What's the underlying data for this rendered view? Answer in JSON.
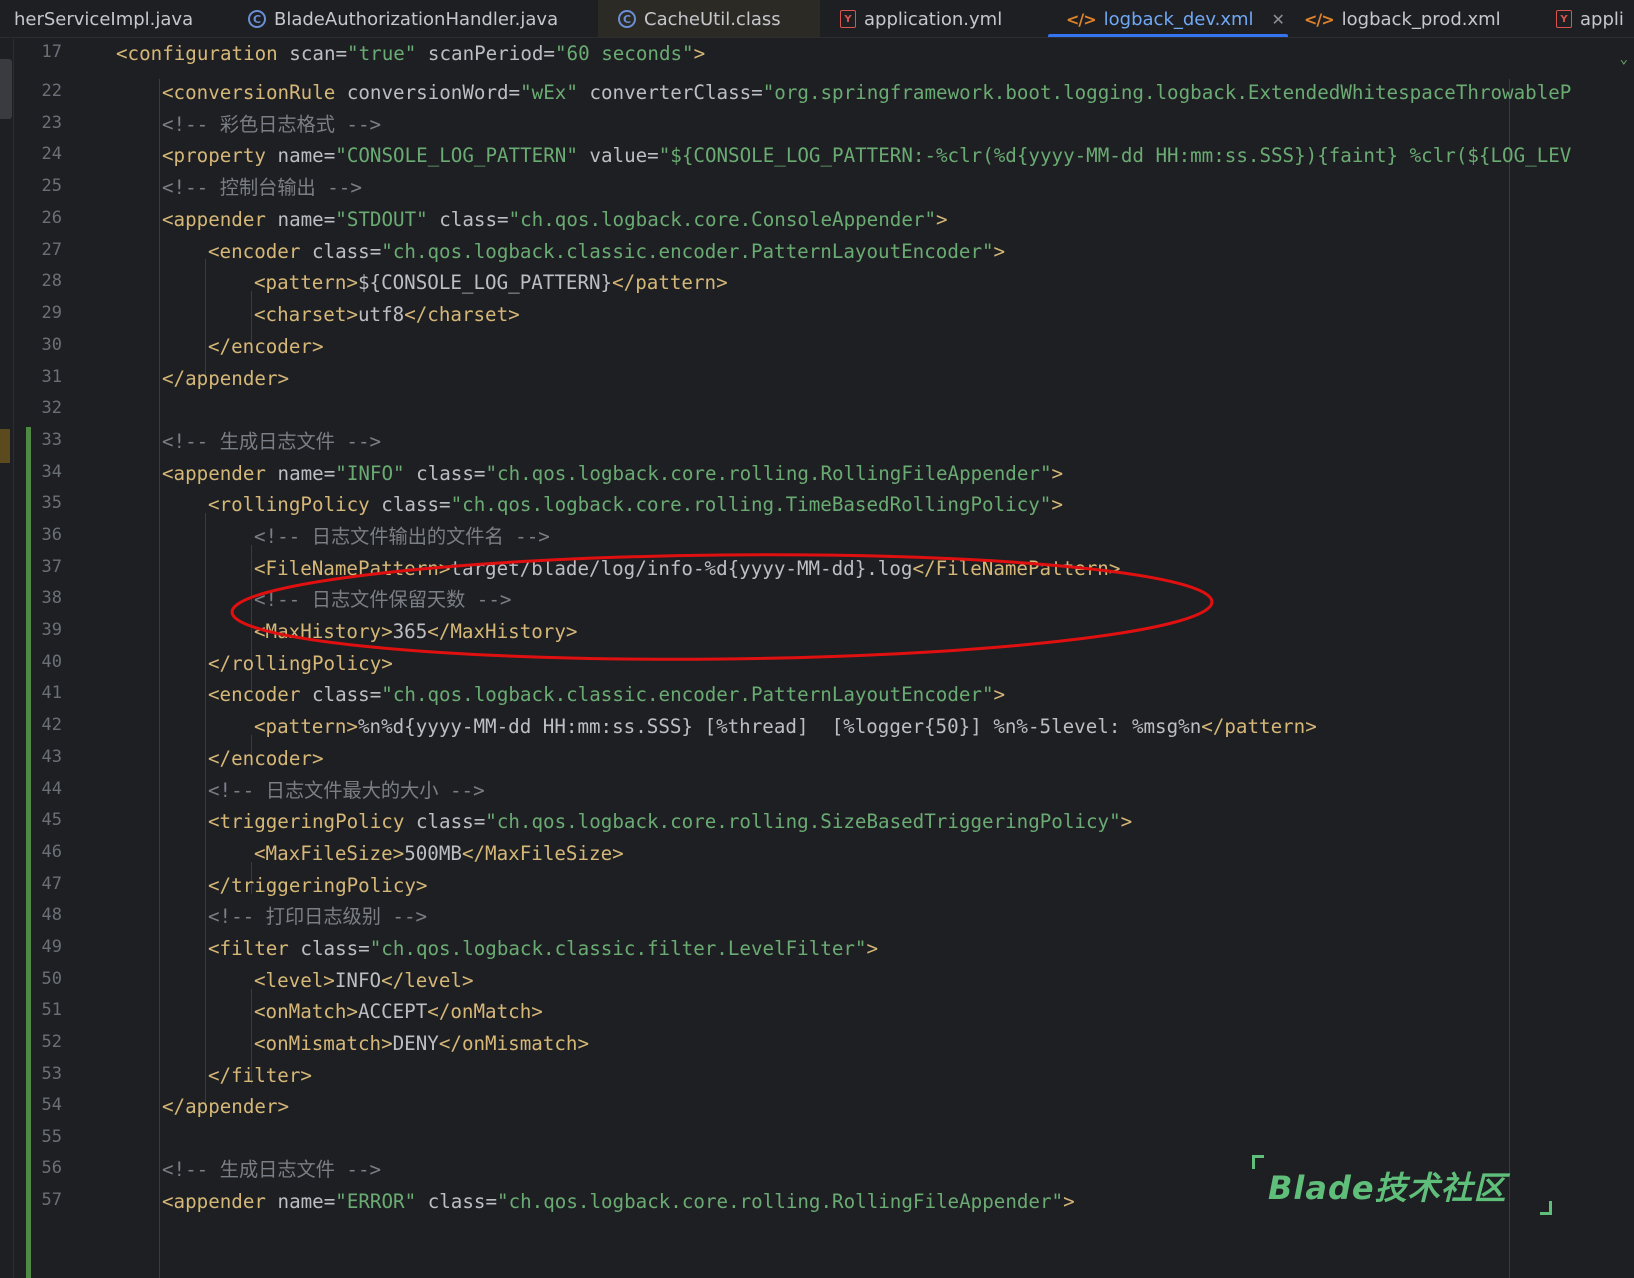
{
  "tabs": [
    {
      "label": "herServiceImpl.java",
      "icon": "none",
      "active": false
    },
    {
      "label": "BladeAuthorizationHandler.java",
      "icon": "class-icon",
      "active": false
    },
    {
      "label": "CacheUtil.class",
      "icon": "class-icon",
      "active": false
    },
    {
      "label": "application.yml",
      "icon": "yaml-icon",
      "active": false
    },
    {
      "label": "logback_dev.xml",
      "icon": "xml-icon",
      "active": true
    },
    {
      "label": "logback_prod.xml",
      "icon": "xml-icon",
      "active": false
    },
    {
      "label": "appli",
      "icon": "yaml-icon",
      "active": false
    }
  ],
  "line_numbers": [
    "17",
    "22",
    "23",
    "24",
    "25",
    "26",
    "27",
    "28",
    "29",
    "30",
    "31",
    "32",
    "33",
    "34",
    "35",
    "36",
    "37",
    "38",
    "39",
    "40",
    "41",
    "42",
    "43",
    "44",
    "45",
    "46",
    "47",
    "48",
    "49",
    "50",
    "51",
    "52",
    "53",
    "54",
    "55",
    "56",
    "57"
  ],
  "code": {
    "l17": {
      "t1": "<configuration",
      "a1": " scan=",
      "v1": "\"true\"",
      "a2": " scanPeriod=",
      "v2": "\"60 seconds\"",
      "t2": ">"
    },
    "l22": {
      "t1": "<conversionRule",
      "a1": " conversionWord=",
      "v1": "\"wEx\"",
      "a2": " converterClass=",
      "v2": "\"org.springframework.boot.logging.logback.ExtendedWhitespaceThrowableP"
    },
    "l23": "<!-- 彩色日志格式 -->",
    "l24": {
      "t1": "<property",
      "a1": " name=",
      "v1": "\"CONSOLE_LOG_PATTERN\"",
      "a2": " value=",
      "v2": "\"${CONSOLE_LOG_PATTERN:-%clr(%d{yyyy-MM-dd HH:mm:ss.SSS}){faint} %clr(${LOG_LEV"
    },
    "l25": "<!-- 控制台输出 -->",
    "l26": {
      "t1": "<appender",
      "a1": " name=",
      "v1": "\"STDOUT\"",
      "a2": " class=",
      "v2": "\"ch.qos.logback.core.ConsoleAppender\"",
      "t2": ">"
    },
    "l27": {
      "t1": "<encoder",
      "a1": " class=",
      "v1": "\"ch.qos.logback.classic.encoder.PatternLayoutEncoder\"",
      "t2": ">"
    },
    "l28": {
      "t1": "<pattern>",
      "x": "${CONSOLE_LOG_PATTERN}",
      "t2": "</pattern>"
    },
    "l29": {
      "t1": "<charset>",
      "x": "utf8",
      "t2": "</charset>"
    },
    "l30": "</encoder>",
    "l31": "</appender>",
    "l33": "<!-- 生成日志文件 -->",
    "l34": {
      "t1": "<appender",
      "a1": " name=",
      "v1": "\"INFO\"",
      "a2": " class=",
      "v2": "\"ch.qos.logback.core.rolling.RollingFileAppender\"",
      "t2": ">"
    },
    "l35": {
      "t1": "<rollingPolicy",
      "a1": " class=",
      "v1": "\"ch.qos.logback.core.rolling.TimeBasedRollingPolicy\"",
      "t2": ">"
    },
    "l36": "<!-- 日志文件输出的文件名 -->",
    "l37": {
      "t1": "<FileNamePattern>",
      "x": "target/blade/log/info-%d{yyyy-MM-dd}.log",
      "t2": "</FileNamePattern>"
    },
    "l38": "<!-- 日志文件保留天数 -->",
    "l39": {
      "t1": "<MaxHistory>",
      "x": "365",
      "t2": "</MaxHistory>"
    },
    "l40": "</rollingPolicy>",
    "l41": {
      "t1": "<encoder",
      "a1": " class=",
      "v1": "\"ch.qos.logback.classic.encoder.PatternLayoutEncoder\"",
      "t2": ">"
    },
    "l42": {
      "t1": "<pattern>",
      "x": "%n%d{yyyy-MM-dd HH:mm:ss.SSS} [%thread]  [%logger{50}] %n%-5level: %msg%n",
      "t2": "</pattern>"
    },
    "l43": "</encoder>",
    "l44": "<!-- 日志文件最大的大小 -->",
    "l45": {
      "t1": "<triggeringPolicy",
      "a1": " class=",
      "v1": "\"ch.qos.logback.core.rolling.SizeBasedTriggeringPolicy\"",
      "t2": ">"
    },
    "l46": {
      "t1": "<MaxFileSize>",
      "x": "500MB",
      "t2": "</MaxFileSize>"
    },
    "l47": "</triggeringPolicy>",
    "l48": "<!-- 打印日志级别 -->",
    "l49": {
      "t1": "<filter",
      "a1": " class=",
      "v1": "\"ch.qos.logback.classic.filter.LevelFilter\"",
      "t2": ">"
    },
    "l50": {
      "t1": "<level>",
      "x": "INFO",
      "t2": "</level>"
    },
    "l51": {
      "t1": "<onMatch>",
      "x": "ACCEPT",
      "t2": "</onMatch>"
    },
    "l52": {
      "t1": "<onMismatch>",
      "x": "DENY",
      "t2": "</onMismatch>"
    },
    "l53": "</filter>",
    "l54": "</appender>",
    "l56": "<!-- 生成日志文件 -->",
    "l57": {
      "t1": "<appender",
      "a1": " name=",
      "v1": "\"ERROR\"",
      "a2": " class=",
      "v2": "\"ch.qos.logback.core.rolling.RollingFileAppender\"",
      "t2": ">"
    }
  },
  "watermark": "Blade技术社区",
  "colors": {
    "background": "#1e1f22",
    "tag": "#d5b778",
    "attr_value": "#6aab73",
    "comment": "#7a7e85",
    "active_tab": "#3574f0",
    "annotation_ellipse": "#e01010",
    "watermark": "#5fbf7a"
  }
}
